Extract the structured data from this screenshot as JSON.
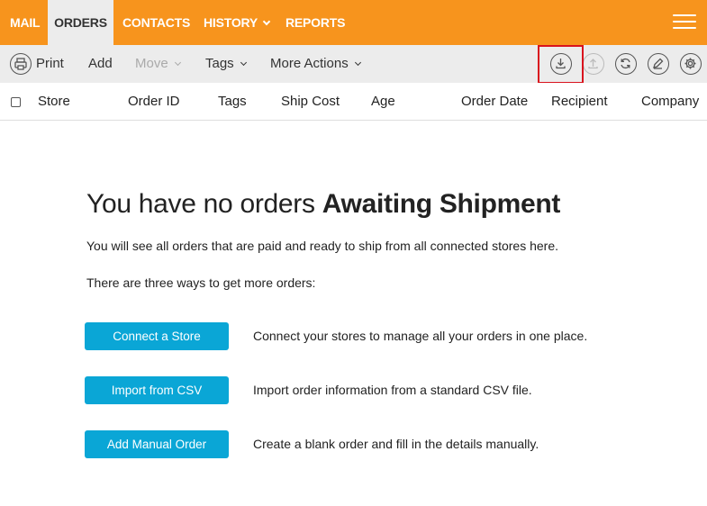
{
  "topnav": {
    "items": [
      {
        "label": "MAIL"
      },
      {
        "label": "ORDERS",
        "active": true
      },
      {
        "label": "CONTACTS"
      },
      {
        "label": "HISTORY",
        "dropdown": true
      },
      {
        "label": "REPORTS"
      }
    ],
    "menu_icon": "hamburger-icon",
    "color": "#f7941d"
  },
  "toolbar": {
    "print_label": "Print",
    "add_label": "Add",
    "move_label": "Move",
    "tags_label": "Tags",
    "more_actions_label": "More Actions",
    "icons": [
      "download-icon",
      "upload-icon",
      "refresh-icon",
      "edit-icon",
      "settings-icon"
    ]
  },
  "table": {
    "columns": [
      "Store",
      "Order ID",
      "Tags",
      "Ship Cost",
      "Age",
      "Order Date",
      "Recipient",
      "Company"
    ]
  },
  "empty_state": {
    "title_prefix": "You have no orders ",
    "title_strong": "Awaiting Shipment",
    "subtitle": "You will see all orders that are paid and ready to ship from all connected stores here.",
    "ways_text": "There are three ways to get more orders:",
    "actions": [
      {
        "button": "Connect a Store",
        "description": "Connect your stores to manage all your orders in one place."
      },
      {
        "button": "Import from CSV",
        "description": "Import order information from a standard CSV file."
      },
      {
        "button": "Add Manual Order",
        "description": "Create a blank order and fill in the details manually."
      }
    ],
    "button_color": "#0aa6d6"
  }
}
